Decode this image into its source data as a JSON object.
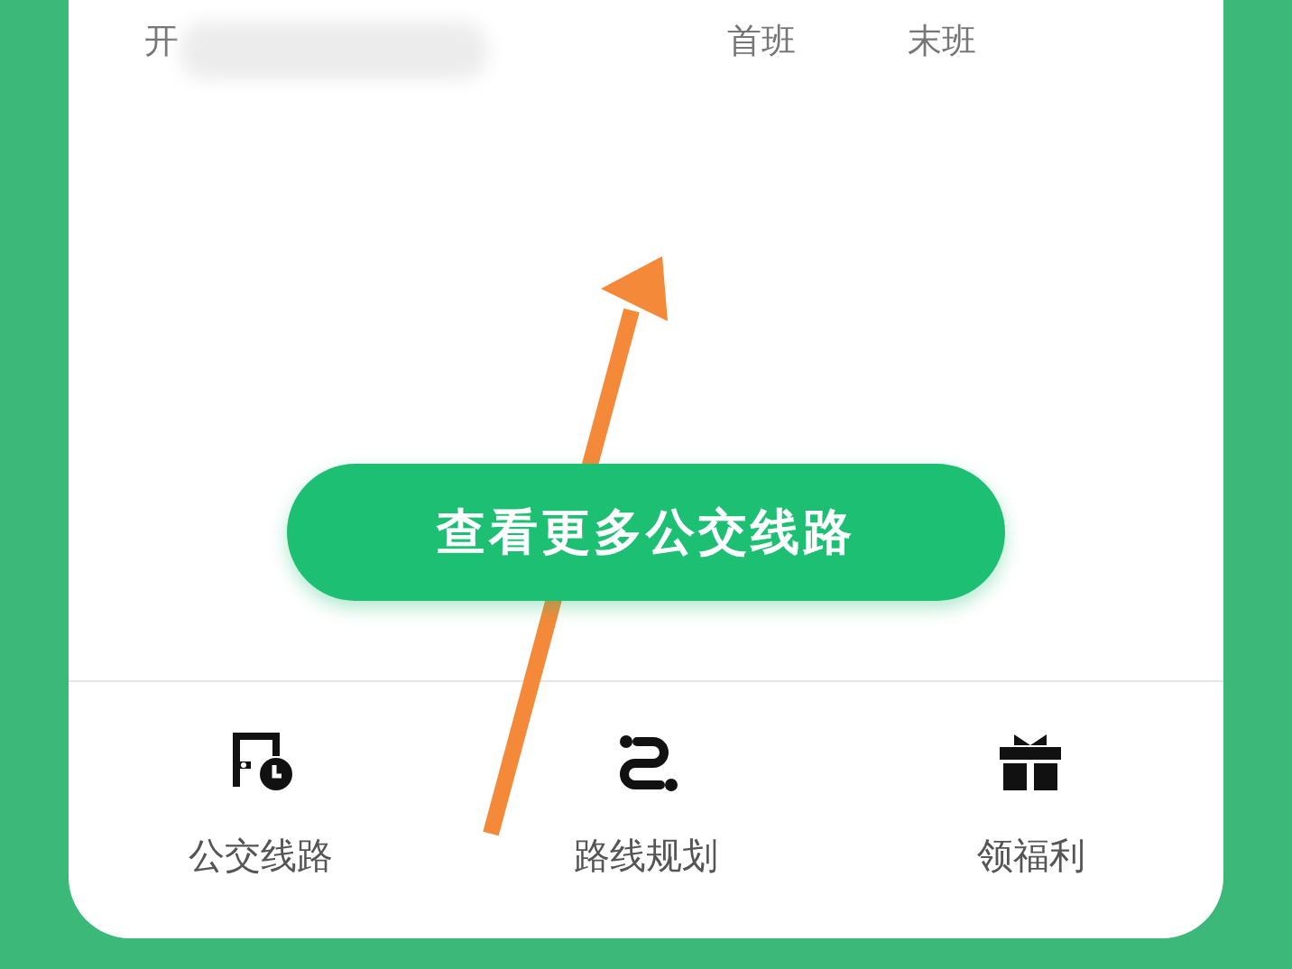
{
  "header": {
    "columns": [
      {
        "label": "开"
      },
      {
        "label": "首班"
      },
      {
        "label": "末班"
      }
    ]
  },
  "more_button": {
    "label": "查看更多公交线路"
  },
  "bottom_nav": [
    {
      "label": "公交线路",
      "kind": "bus"
    },
    {
      "label": "路线规划",
      "kind": "route"
    },
    {
      "label": "领福利",
      "kind": "gift"
    }
  ],
  "annotation": {
    "kind": "arrow"
  }
}
